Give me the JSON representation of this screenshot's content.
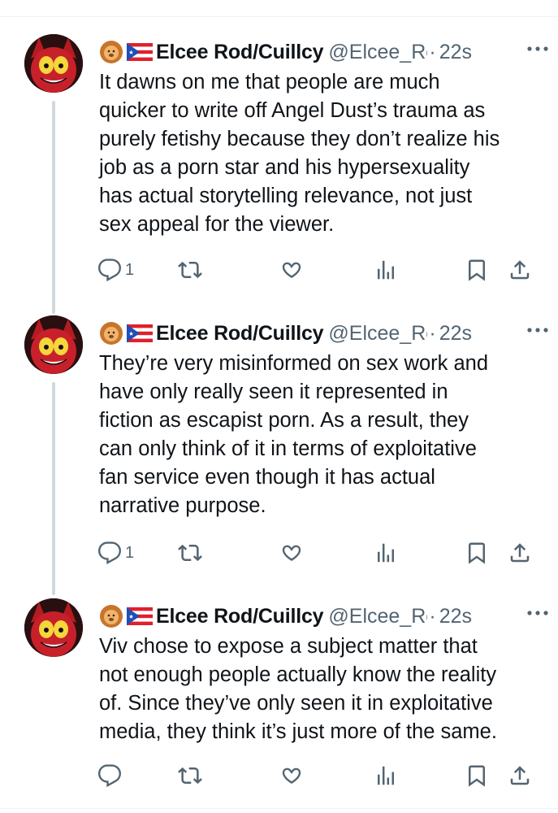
{
  "tweets": [
    {
      "display_name": "Elcee Rod/Cuillcy",
      "handle": "@Elcee_Rc",
      "dot": "·",
      "time": "22s",
      "text": "It dawns on me that people are much\nquicker to write off Angel Dust’s trauma as\npurely fetishy because they don’t realize his\njob as a porn star and his hypersexuality\nhas actual storytelling relevance, not just\nsex appeal for the viewer.",
      "reply_count": "1"
    },
    {
      "display_name": "Elcee Rod/Cuillcy",
      "handle": "@Elcee_Rc",
      "dot": "·",
      "time": "22s",
      "text": "They’re very misinformed on sex work and\nhave only really seen it represented in\nfiction as escapist porn. As a result, they\ncan only think of it in terms of exploitative\nfan service even though it has actual\nnarrative purpose.",
      "reply_count": "1"
    },
    {
      "display_name": "Elcee Rod/Cuillcy",
      "handle": "@Elcee_Rc",
      "dot": "·",
      "time": "22s",
      "text": "Viv chose to expose a subject matter that\nnot enough people actually know the reality\nof. Since they’ve only seen it in exploitative\nmedia, they think it’s just more of the same.",
      "reply_count": ""
    }
  ],
  "icons": {
    "reply": "reply-icon",
    "repost": "repost-icon",
    "like": "like-icon",
    "views": "views-icon",
    "bookmark": "bookmark-icon",
    "share": "share-icon",
    "more": "more-icon",
    "lion_emoji": "lion-face-icon",
    "flag_emoji": "puerto-rico-flag-icon"
  },
  "colors": {
    "text": "#0f1419",
    "secondary": "#536471",
    "thread_line": "#cfd9de"
  }
}
